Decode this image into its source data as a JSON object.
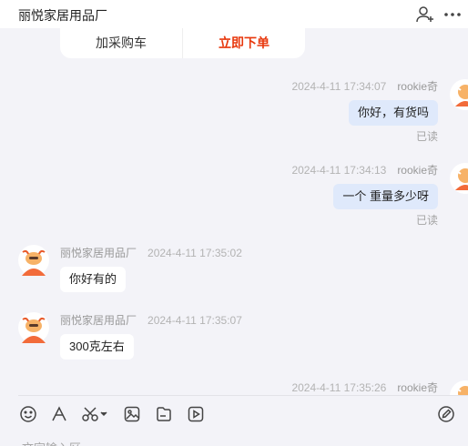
{
  "header": {
    "title": "丽悦家居用品厂",
    "add_contact_icon": "person-add-icon",
    "more_icon": "more-dots-icon"
  },
  "product_actions": {
    "add_to_cart": "加采购车",
    "buy_now": "立即下单"
  },
  "messages": [
    {
      "side": "out",
      "sender": "rookie奇",
      "timestamp": "2024-4-11 17:34:07",
      "text": "你好，有货吗",
      "status": "已读"
    },
    {
      "side": "out",
      "sender": "rookie奇",
      "timestamp": "2024-4-11 17:34:13",
      "text": "一个 重量多少呀",
      "status": "已读"
    },
    {
      "side": "in",
      "sender": "丽悦家居用品厂",
      "timestamp": "2024-4-11 17:35:02",
      "text": "你好有的"
    },
    {
      "side": "in",
      "sender": "丽悦家居用品厂",
      "timestamp": "2024-4-11 17:35:07",
      "text": "300克左右"
    },
    {
      "side": "out",
      "sender": "rookie奇",
      "timestamp": "2024-4-11 17:35:26"
    }
  ],
  "toolbar": {
    "icons": [
      "emoji-icon",
      "font-icon",
      "scissors-icon",
      "image-icon",
      "file-icon",
      "video-icon",
      "edit-icon"
    ],
    "input_placeholder": "文字输入区"
  },
  "colors": {
    "accent_red": "#e8380d",
    "outgoing_bubble": "#dfe9fb",
    "background": "#f3f3f8"
  }
}
